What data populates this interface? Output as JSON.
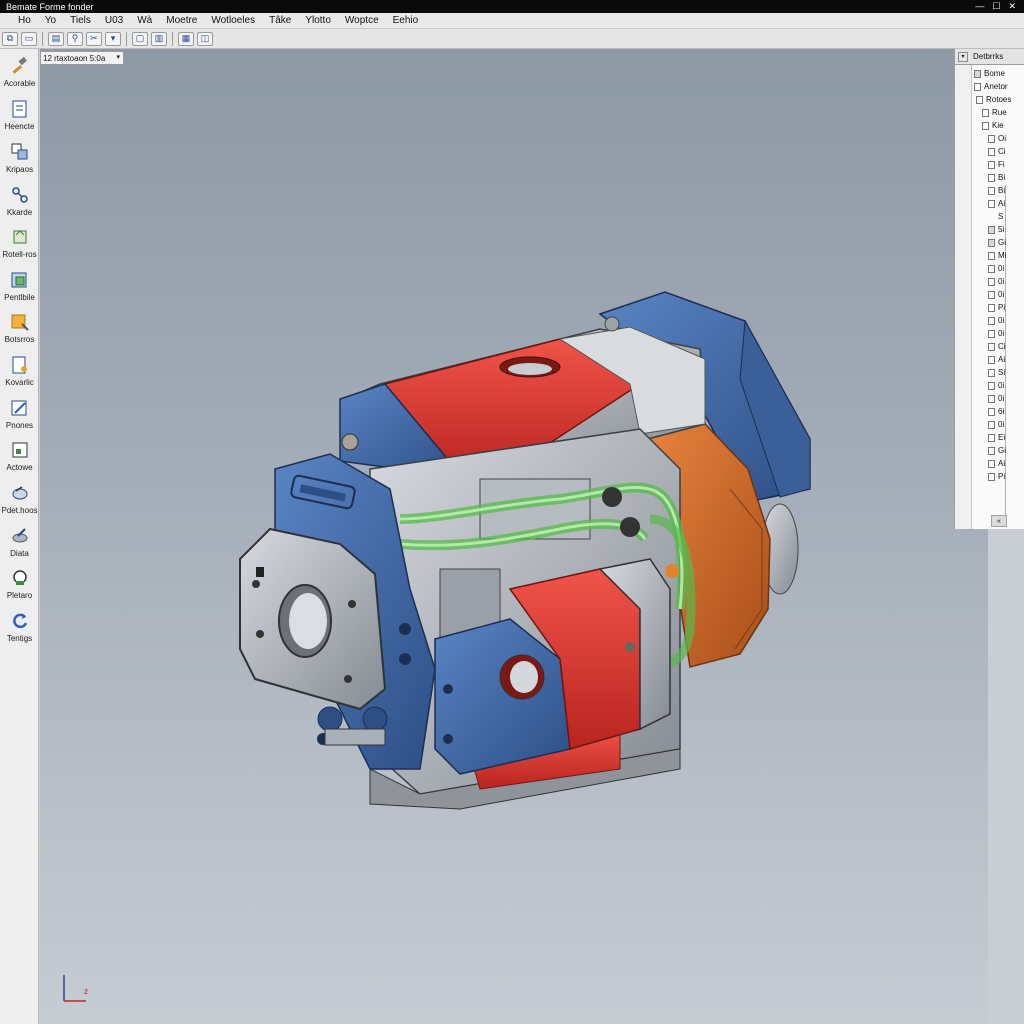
{
  "window": {
    "title": "Bemate Forme fonder",
    "controls": [
      "—",
      "☐",
      "✕"
    ]
  },
  "menu": [
    "Ho",
    "Yo",
    "Tiels",
    "U03",
    "Wà",
    "Moetre",
    "Wotloeles",
    "Tâke",
    "Ylotto",
    "Woptce",
    "Eehio"
  ],
  "toolbar": {
    "icons": [
      "copy-icon",
      "open-icon",
      "save-icon",
      "link-icon",
      "cut-icon",
      "dropdown-icon",
      "frame-icon",
      "layer-icon",
      "grid-icon",
      "view-icon"
    ]
  },
  "left_tools": [
    {
      "label": "Acorable",
      "icon": "hammer-icon"
    },
    {
      "label": "Heencte",
      "icon": "sketch-icon"
    },
    {
      "label": "Kripaos",
      "icon": "parts-icon"
    },
    {
      "label": "Kkarde",
      "icon": "constraint-icon"
    },
    {
      "label": "Rotell-ros",
      "icon": "rotate-icon"
    },
    {
      "label": "Pentlbile",
      "icon": "feature-icon"
    },
    {
      "label": "Botsrros",
      "icon": "pattern-icon"
    },
    {
      "label": "Kovarlic",
      "icon": "document-icon"
    },
    {
      "label": "Pnones",
      "icon": "edit-icon"
    },
    {
      "label": "Actowe",
      "icon": "plot-icon"
    },
    {
      "label": "Pdet.hoos",
      "icon": "measure-icon"
    },
    {
      "label": "Diata",
      "icon": "blend-icon"
    },
    {
      "label": "Pletaro",
      "icon": "inspect-icon"
    },
    {
      "label": "Tentigs",
      "icon": "refresh-icon"
    }
  ],
  "viewport": {
    "view_selector": "12 rtaxtoaon 5:0a"
  },
  "browser": {
    "header": "Detbrrks",
    "items": [
      "Bome",
      "Anetor",
      "Rotoes",
      "Rue",
      "Kie",
      "Oi",
      "Ci",
      "Fi",
      "Bi",
      "Bi",
      "Ai",
      "S",
      "5i",
      "Gi",
      "Mi",
      "0i",
      "0i",
      "0i",
      "Pi",
      "0i",
      "0i",
      "Ci",
      "Ai",
      "Si",
      "0i",
      "0i",
      "6i",
      "0i",
      "Ei",
      "Gi",
      "Ai",
      "Pi",
      "«"
    ]
  },
  "triad": {
    "label": "z"
  },
  "colors": {
    "red": "#d9342e",
    "blue": "#3e64a0",
    "orange": "#d36a28",
    "green": "#7fd36c",
    "metal": "#9ea3aa"
  }
}
